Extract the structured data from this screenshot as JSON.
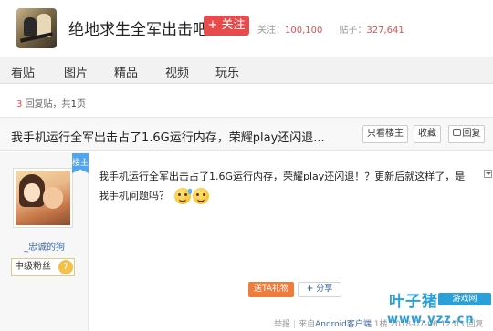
{
  "header": {
    "forum_name": "绝地求生全军出击吧",
    "follow_label": "+ 关注",
    "followers_label": "关注：",
    "followers_value": "100,100",
    "posts_label": "贴子：",
    "posts_value": "327,641"
  },
  "nav": {
    "items": [
      {
        "label": "看贴"
      },
      {
        "label": "图片"
      },
      {
        "label": "精品"
      },
      {
        "label": "视频"
      },
      {
        "label": "玩乐"
      }
    ]
  },
  "reply_info": {
    "count": "3",
    "count_suffix": "回复贴，共",
    "pages": "1",
    "pages_suffix": "页"
  },
  "thread": {
    "title": "我手机运行全军出击占了1.6G运行内存，荣耀play还闪退...",
    "only_op_label": "只看楼主",
    "favorite_label": "收藏",
    "reply_label": "回复"
  },
  "author": {
    "op_tag": "楼主",
    "username": "_忠诚的狗",
    "level_title": "中级粉丝",
    "level_number": "7"
  },
  "post": {
    "text": "我手机运行全军出击占了1.6G运行内存，荣耀play还闪退！？更新后就这样了，是我手机问题吗？",
    "gift_label": "送TA礼物",
    "share_label": "分享",
    "report_label": "举报",
    "source_prefix": "来自",
    "source_client": "Android客户端",
    "floor": "1楼",
    "timestamp": "2018-07-06 12:03",
    "reply_link": "回复"
  },
  "watermark": {
    "cn_name": "叶子猪",
    "tag": "游戏网",
    "url": "www.yzz.cn"
  },
  "colors": {
    "accent_red": "#e84b4b",
    "link_blue": "#3d6aa6",
    "gift_orange": "#f07c3c",
    "watermark_blue": "#2a9fd8"
  }
}
